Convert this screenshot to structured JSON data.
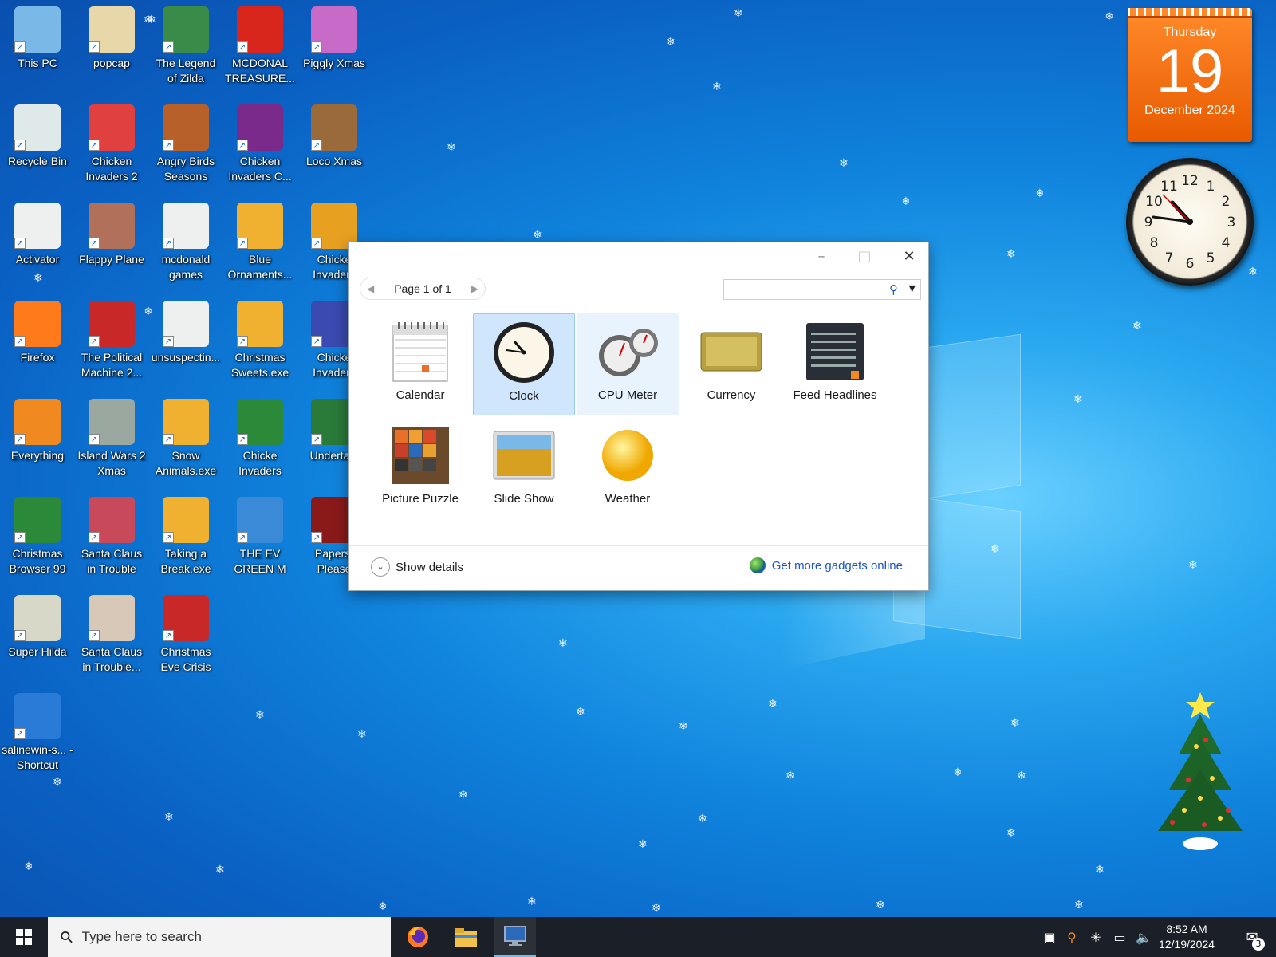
{
  "desktop": {
    "icons": [
      {
        "label": "This PC",
        "icon": "computer-icon",
        "color": "#7ab8e8"
      },
      {
        "label": "popcap",
        "icon": "folder-icon",
        "color": "#e8d7a8"
      },
      {
        "label": "The Legend of Zilda",
        "icon": "game-icon",
        "color": "#3a8a4a"
      },
      {
        "label": "MCDONAL TREASURE...",
        "icon": "mcdonalds-icon",
        "color": "#d8261c"
      },
      {
        "label": "Piggly Xmas",
        "icon": "game-icon",
        "color": "#c86bc8"
      },
      {
        "label": "Recycle Bin",
        "icon": "recycle-bin-icon",
        "color": "#dfe9ea"
      },
      {
        "label": "Chicken Invaders 2",
        "icon": "chicken-icon",
        "color": "#e04040"
      },
      {
        "label": "Angry Birds Seasons",
        "icon": "angry-birds-icon",
        "color": "#b8602a"
      },
      {
        "label": "Chicken Invaders C...",
        "icon": "chicken-icon",
        "color": "#7a2a8a"
      },
      {
        "label": "Loco Xmas",
        "icon": "game-icon",
        "color": "#9a6a3a"
      },
      {
        "label": "Activator",
        "icon": "folder-icon",
        "color": "#eef0f0"
      },
      {
        "label": "Flappy Plane",
        "icon": "game-icon",
        "color": "#b0705a"
      },
      {
        "label": "mcdonald games",
        "icon": "folder-icon",
        "color": "#eef0f0"
      },
      {
        "label": "Blue Ornaments...",
        "icon": "setup-icon",
        "color": "#f0b030"
      },
      {
        "label": "Chicke Invaders",
        "icon": "chicken-icon",
        "color": "#e8a020"
      },
      {
        "label": "Firefox",
        "icon": "firefox-icon",
        "color": "#ff7a1a"
      },
      {
        "label": "The Political Machine 2...",
        "icon": "game-icon",
        "color": "#c82828"
      },
      {
        "label": "unsuspectin...",
        "icon": "file-icon",
        "color": "#eef0f0"
      },
      {
        "label": "Christmas Sweets.exe",
        "icon": "setup-icon",
        "color": "#f0b030"
      },
      {
        "label": "Chicke Invaders",
        "icon": "chicken-icon",
        "color": "#3a4ab0"
      },
      {
        "label": "Everything",
        "icon": "magnifier-icon",
        "color": "#f08a20"
      },
      {
        "label": "Island Wars 2 Xmas",
        "icon": "game-icon",
        "color": "#9aa8a0"
      },
      {
        "label": "Snow Animals.exe",
        "icon": "setup-icon",
        "color": "#f0b030"
      },
      {
        "label": "Chicke Invaders",
        "icon": "chicken-icon",
        "color": "#2a8a3a"
      },
      {
        "label": "Undertale",
        "icon": "game-icon",
        "color": "#2a7a3a"
      },
      {
        "label": "Christmas Browser 99",
        "icon": "christmas-tree-icon",
        "color": "#2a8a3a"
      },
      {
        "label": "Santa Claus in Trouble",
        "icon": "santa-icon",
        "color": "#c84a5a"
      },
      {
        "label": "Taking a Break.exe",
        "icon": "setup-icon",
        "color": "#f0b030"
      },
      {
        "label": "THE EV GREEN M",
        "icon": "messenger-icon",
        "color": "#3a8ad8"
      },
      {
        "label": "Papers, Please",
        "icon": "game-icon",
        "color": "#8a1a1a"
      },
      {
        "label": "Super Hilda",
        "icon": "game-icon",
        "color": "#d8d8c8"
      },
      {
        "label": "Santa Claus in Trouble...",
        "icon": "santa-icon",
        "color": "#d8c8b8"
      },
      {
        "label": "Christmas Eve Crisis",
        "icon": "santa-icon",
        "color": "#c82828"
      },
      {
        "label": "salinewin-s... - Shortcut",
        "icon": "window-icon",
        "color": "#2a7ad8"
      }
    ]
  },
  "gadgets_desktop": {
    "calendar": {
      "weekday": "Thursday",
      "day": "19",
      "month_year": "December 2024"
    },
    "clock": {
      "icon": "analog-clock-icon"
    }
  },
  "gadget_window": {
    "pager_label": "Page 1 of 1",
    "search_placeholder": "",
    "gadgets": [
      {
        "label": "Calendar",
        "icon": "calendar-icon",
        "state": ""
      },
      {
        "label": "Clock",
        "icon": "clock-icon",
        "state": "selected"
      },
      {
        "label": "CPU Meter",
        "icon": "cpu-meter-icon",
        "state": "hover"
      },
      {
        "label": "Currency",
        "icon": "currency-icon",
        "state": ""
      },
      {
        "label": "Feed Headlines",
        "icon": "feed-icon",
        "state": ""
      },
      {
        "label": "Picture Puzzle",
        "icon": "puzzle-icon",
        "state": ""
      },
      {
        "label": "Slide Show",
        "icon": "slideshow-icon",
        "state": ""
      },
      {
        "label": "Weather",
        "icon": "weather-icon",
        "state": ""
      }
    ],
    "show_details_label": "Show details",
    "get_more_label": "Get more gadgets online",
    "link_color": "#1a55c8",
    "selected_color": "#cfe6fc"
  },
  "taskbar": {
    "search_placeholder": "Type here to search",
    "time": "8:52 AM",
    "date": "12/19/2024",
    "notification_count": "3",
    "apps": [
      {
        "name": "firefox",
        "icon": "firefox-icon"
      },
      {
        "name": "file-explorer",
        "icon": "folder-icon"
      },
      {
        "name": "gadgets",
        "icon": "monitor-icon"
      }
    ]
  }
}
